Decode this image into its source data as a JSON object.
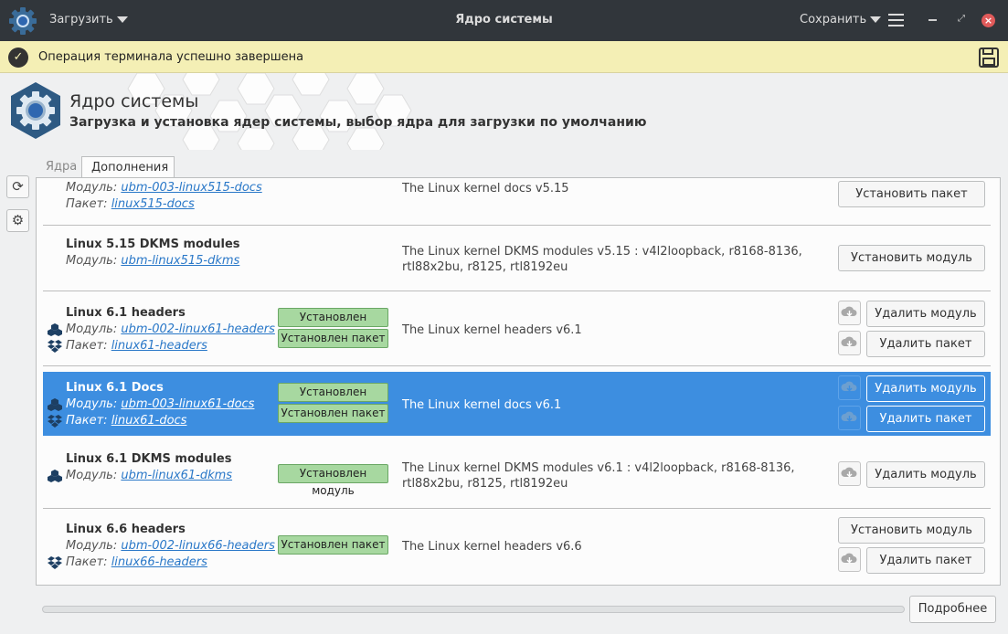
{
  "titlebar": {
    "load_label": "Загрузить",
    "title": "Ядро системы",
    "save_label": "Сохранить"
  },
  "notification": {
    "text": "Операция терминала успешно завершена"
  },
  "header": {
    "title": "Ядро системы",
    "subtitle": "Загрузка и установка ядер системы, выбор ядра для загрузки по умолчанию"
  },
  "tabs": {
    "kernels": "Ядра",
    "addons": "Дополнения"
  },
  "labels": {
    "module": "Модуль:",
    "package": "Пакет:"
  },
  "rows": {
    "r0": {
      "module": "ubm-003-linux515-docs",
      "package": "linux515-docs",
      "desc": "The Linux kernel docs v5.15",
      "btn1": "Установить пакет"
    },
    "r1": {
      "title": "Linux 5.15 DKMS modules",
      "module": "ubm-linux515-dkms",
      "desc": "The Linux kernel DKMS modules v5.15 : v4l2loopback, r8168-8136, rtl88x2bu, r8125, rtl8192eu",
      "btn1": "Установить модуль"
    },
    "r2": {
      "title": "Linux 6.1 headers",
      "module": "ubm-002-linux61-headers",
      "package": "linux61-headers",
      "badge_module": "Установлен модуль",
      "badge_package": "Установлен пакет",
      "desc": "The Linux kernel headers v6.1",
      "btn1": "Удалить модуль",
      "btn2": "Удалить пакет"
    },
    "r3": {
      "title": "Linux 6.1 Docs",
      "module": "ubm-003-linux61-docs",
      "package": "linux61-docs",
      "badge_module": "Установлен модуль",
      "badge_package": "Установлен пакет",
      "desc": "The Linux kernel docs v6.1",
      "btn1": "Удалить модуль",
      "btn2": "Удалить пакет"
    },
    "r4": {
      "title": "Linux 6.1 DKMS modules",
      "module": "ubm-linux61-dkms",
      "badge_module": "Установлен модуль",
      "desc": "The Linux kernel DKMS modules v6.1 : v4l2loopback, r8168-8136, rtl88x2bu, r8125, rtl8192eu",
      "btn1": "Удалить модуль"
    },
    "r5": {
      "title": "Linux 6.6 headers",
      "module": "ubm-002-linux66-headers",
      "package": "linux66-headers",
      "badge_package": "Установлен пакет",
      "desc": "The Linux kernel headers v6.6",
      "btn1": "Установить модуль",
      "btn2": "Удалить пакет"
    }
  },
  "bottom": {
    "more_label": "Подробнее"
  },
  "colors": {
    "titlebar": "#31363b",
    "notification": "#f4efb5",
    "selection": "#3d8ee0",
    "badge": "#a7d8a0",
    "link": "#2a78c8"
  }
}
